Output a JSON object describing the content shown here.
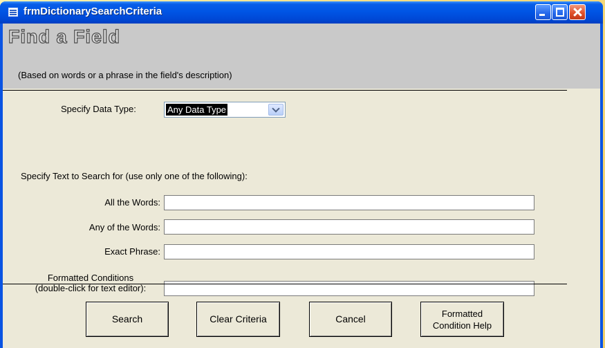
{
  "window": {
    "title": "frmDictionarySearchCriteria",
    "icon": "form-icon"
  },
  "header": {
    "title": "Find a Field",
    "subtitle": "(Based on words or a phrase in the field's description)"
  },
  "datatype": {
    "label": "Specify Data Type:",
    "selected": "Any Data Type"
  },
  "search": {
    "instructions": "Specify Text to Search for (use only one of the following):",
    "all_words_label": "All the Words:",
    "all_words_value": "",
    "any_words_label": "Any of the Words:",
    "any_words_value": "",
    "exact_label": "Exact Phrase:",
    "exact_value": "",
    "formatted_label_line1": "Formatted Conditions",
    "formatted_label_line2": "(double-click for text editor):",
    "formatted_value": ""
  },
  "buttons": {
    "search": "Search",
    "clear": "Clear Criteria",
    "cancel": "Cancel",
    "help_line1": "Formatted",
    "help_line2": "Condition Help"
  },
  "colors": {
    "titlebar": "#0055e5",
    "client": "#ece9d8",
    "header_band": "#c9c9c9",
    "close_button": "#e0512c"
  }
}
